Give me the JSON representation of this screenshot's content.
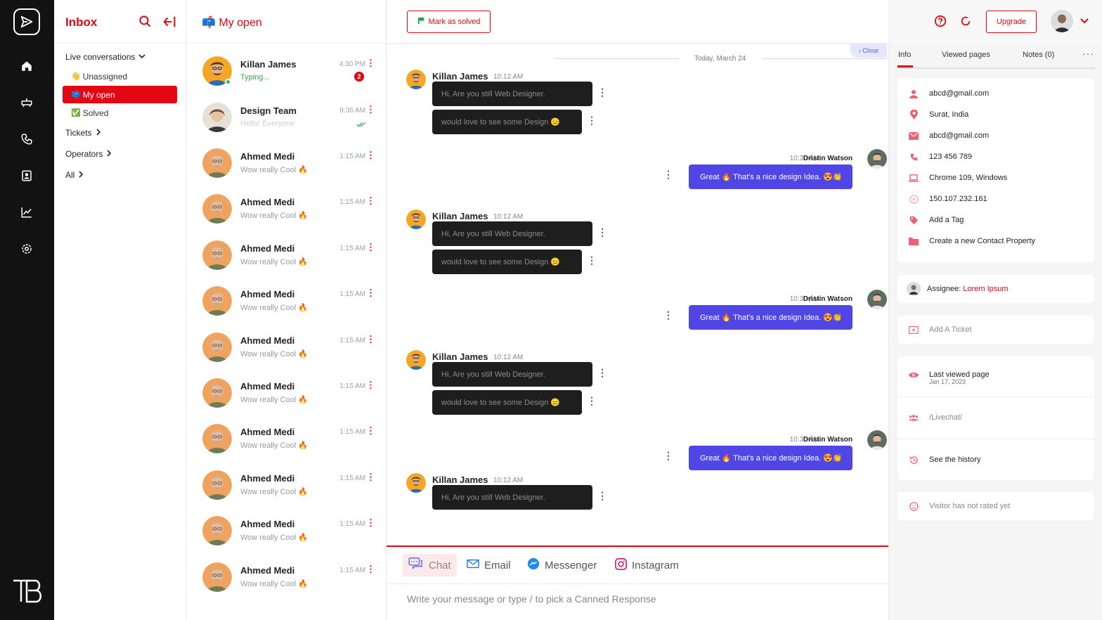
{
  "rail": {
    "icons": [
      "send-logo-icon",
      "home-icon",
      "stack-icon",
      "phone-user-icon",
      "contact-card-icon",
      "analytics-icon",
      "settings-icon"
    ],
    "brand": "TB"
  },
  "nav": {
    "title": "Inbox",
    "live_conversations": "Live conversations",
    "unassigned": "Unassigned",
    "unassigned_emoji": "👋",
    "my_open": "My open",
    "my_open_emoji": "📫",
    "solved": "Solved",
    "solved_emoji": "✅",
    "tickets": "Tickets",
    "operators": "Operators",
    "all": "All"
  },
  "list": {
    "title": "My open",
    "title_emoji": "📫",
    "conversations": [
      {
        "name": "Killan James",
        "preview": "Typing...",
        "time": "4:30 PM",
        "badge": "2",
        "status": "typing"
      },
      {
        "name": "Design Team",
        "preview": "Hello! Everyone",
        "time": "9:36 AM",
        "status": "read"
      },
      {
        "name": "Ahmed Medi",
        "preview": "Wow really Cool 🔥",
        "time": "1:15 AM"
      },
      {
        "name": "Ahmed Medi",
        "preview": "Wow really Cool 🔥",
        "time": "1:15 AM"
      },
      {
        "name": "Ahmed Medi",
        "preview": "Wow really Cool 🔥",
        "time": "1:15 AM"
      },
      {
        "name": "Ahmed Medi",
        "preview": "Wow really Cool 🔥",
        "time": "1:15 AM"
      },
      {
        "name": "Ahmed Medi",
        "preview": "Wow really Cool 🔥",
        "time": "1:15 AM"
      },
      {
        "name": "Ahmed Medi",
        "preview": "Wow really Cool 🔥",
        "time": "1:15 AM"
      },
      {
        "name": "Ahmed Medi",
        "preview": "Wow really Cool 🔥",
        "time": "1:15 AM"
      },
      {
        "name": "Ahmed Medi",
        "preview": "Wow really Cool 🔥",
        "time": "1:15 AM"
      },
      {
        "name": "Ahmed Medi",
        "preview": "Wow really Cool 🔥",
        "time": "1:15 AM"
      },
      {
        "name": "Ahmed Medi",
        "preview": "Wow really Cool 🔥",
        "time": "1:15 AM"
      }
    ]
  },
  "chat": {
    "mark_solved": "Mark as solved",
    "close": "Close",
    "date": "Today, March 24",
    "incoming": {
      "name": "Killan James",
      "time": "10:12 AM",
      "msg1": "Hi, Are you still Web Designer.",
      "msg2": "would love to see some Design 😑"
    },
    "outgoing": {
      "name": "Dristin Watson",
      "time": "10:30 AM",
      "msg": "Great 🔥 That's a nice design Idea. 😍👏"
    },
    "channels": {
      "chat": "Chat",
      "email": "Email",
      "messenger": "Messenger",
      "instagram": "Instagram"
    },
    "input_placeholder": "Write your message or type / to pick a Canned Response"
  },
  "header": {
    "upgrade": "Upgrade"
  },
  "info": {
    "tabs": {
      "info": "Info",
      "viewed": "Viewed pages",
      "notes": "Notes (0)"
    },
    "email1": "abcd@gmail.com",
    "location": "Surat, India",
    "email2": "abcd@gmail.com",
    "phone": "123 456 789",
    "browser": "Chrome 109, Windows",
    "ip": "150.107.232.161",
    "add_tag": "Add a Tag",
    "create_property": "Create a new Contact Property",
    "assignee_label": "Assignee:",
    "assignee_name": "Lorem Ipsum",
    "add_ticket": "Add A Ticket",
    "last_viewed_label": "Last viewed page",
    "last_viewed_date": "Jan 17, 2023",
    "livechat_path": "/Livechat/",
    "history": "See the history",
    "rating": "Visitor has not rated yet"
  },
  "colors": {
    "brand_red": "#e30613",
    "accent_blue": "#5046e5",
    "rail_bg": "#121212"
  }
}
